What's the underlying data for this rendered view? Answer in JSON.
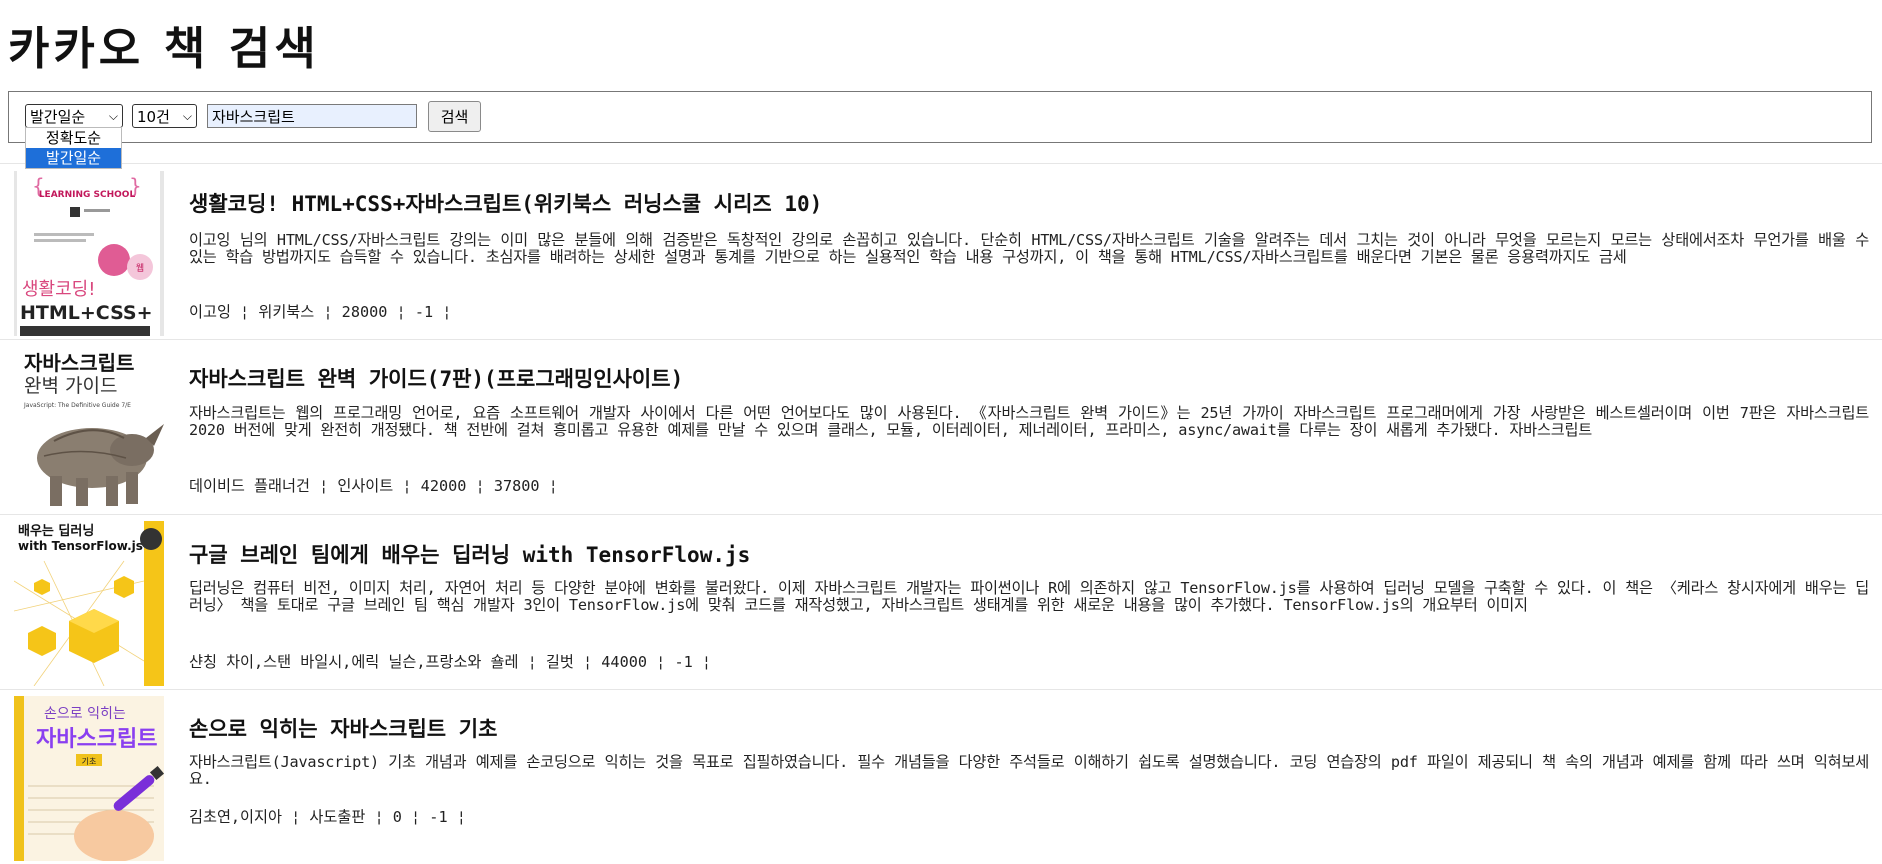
{
  "page": {
    "title": "카카오 책 검색"
  },
  "search": {
    "sort_selected": "발간일순",
    "size_selected": "10건",
    "query": "자바스크립트",
    "button_label": "검색",
    "sort_options": [
      "정확도순",
      "발간일순"
    ]
  },
  "cover_texts": {
    "b1_series": "LEARNING SCHOOL",
    "b1_brand": "생활코딩!",
    "b1_big": "HTML+CSS+",
    "b2_line1": "자바스크립트",
    "b2_line2": "완벽 가이드",
    "b2_sub": "JavaScript: The Definitive Guide 7/E",
    "b3_line1": "배우는 딥러닝",
    "b3_line2": "with TensorFlow.js",
    "b4_line1": "손으로 익히는",
    "b4_line2": "자바스크립트",
    "b4_tag": "기초"
  },
  "books": [
    {
      "title": "생활코딩! HTML+CSS+자바스크립트(위키북스 러닝스쿨 시리즈 10)",
      "description": "이고잉 님의 HTML/CSS/자바스크립트 강의는 이미 많은 분들에 의해 검증받은 독창적인 강의로 손꼽히고 있습니다. 단순히 HTML/CSS/자바스크립트 기술을 알려주는 데서 그치는 것이 아니라 무엇을 모르는지 모르는 상태에서조차 무언가를 배울 수 있는 학습 방법까지도 습득할 수 있습니다. 초심자를 배려하는 상세한 설명과 통계를 기반으로 하는 실용적인 학습 내용 구성까지, 이 책을 통해 HTML/CSS/자바스크립트를 배운다면 기본은 물론 응용력까지도 금세",
      "meta": "이고잉 ¦ 위키북스 ¦ 28000 ¦ -1 ¦"
    },
    {
      "title": "자바스크립트 완벽 가이드(7판)(프로그래밍인사이트)",
      "description": "자바스크립트는 웹의 프로그래밍 언어로, 요즘 소프트웨어 개발자 사이에서 다른 어떤 언어보다도 많이 사용된다. 《자바스크립트 완벽 가이드》는 25년 가까이 자바스크립트 프로그래머에게 가장 사랑받은 베스트셀러이며 이번 7판은 자바스크립트 2020 버전에 맞게 완전히 개정됐다. 책 전반에 걸쳐 흥미롭고 유용한 예제를 만날 수 있으며 클래스, 모듈, 이터레이터, 제너레이터, 프라미스, async/await를 다루는 장이 새롭게 추가됐다. 자바스크립트",
      "meta": "데이비드 플래너건 ¦ 인사이트 ¦ 42000 ¦ 37800 ¦"
    },
    {
      "title": "구글 브레인 팀에게 배우는 딥러닝 with TensorFlow.js",
      "description": "딥러닝은 컴퓨터 비전, 이미지 처리, 자연어 처리 등 다양한 분야에 변화를 불러왔다. 이제 자바스크립트 개발자는 파이썬이나 R에 의존하지 않고 TensorFlow.js를 사용하여 딥러닝 모델을 구축할 수 있다. 이 책은 〈케라스 창시자에게 배우는 딥러닝〉 책을 토대로 구글 브레인 팀 핵심 개발자 3인이 TensorFlow.js에 맞춰 코드를 재작성했고, 자바스크립트 생태계를 위한 새로운 내용을 많이 추가했다. TensorFlow.js의 개요부터 이미지",
      "meta": "샨칭 차이,스탠 바일시,에릭 닐슨,프랑소와 숄레 ¦ 길벗 ¦ 44000 ¦ -1 ¦"
    },
    {
      "title": "손으로 익히는 자바스크립트 기초",
      "description": "자바스크립트(Javascript) 기초 개념과 예제를 손코딩으로 익히는 것을 목표로 집필하였습니다. 필수 개념들을 다양한 주석들로 이해하기 쉽도록 설명했습니다. 코딩 연습장의 pdf 파일이 제공되니 책 속의 개념과 예제를 함께 따라 쓰며 익혀보세요.",
      "meta": "김초연,이지아 ¦ 사도출판 ¦ 0 ¦ -1 ¦"
    }
  ],
  "colors": {
    "accent": "#1e6fd9",
    "input_bg": "#e8f0fe"
  },
  "icons": [
    "chevron-down-icon"
  ]
}
